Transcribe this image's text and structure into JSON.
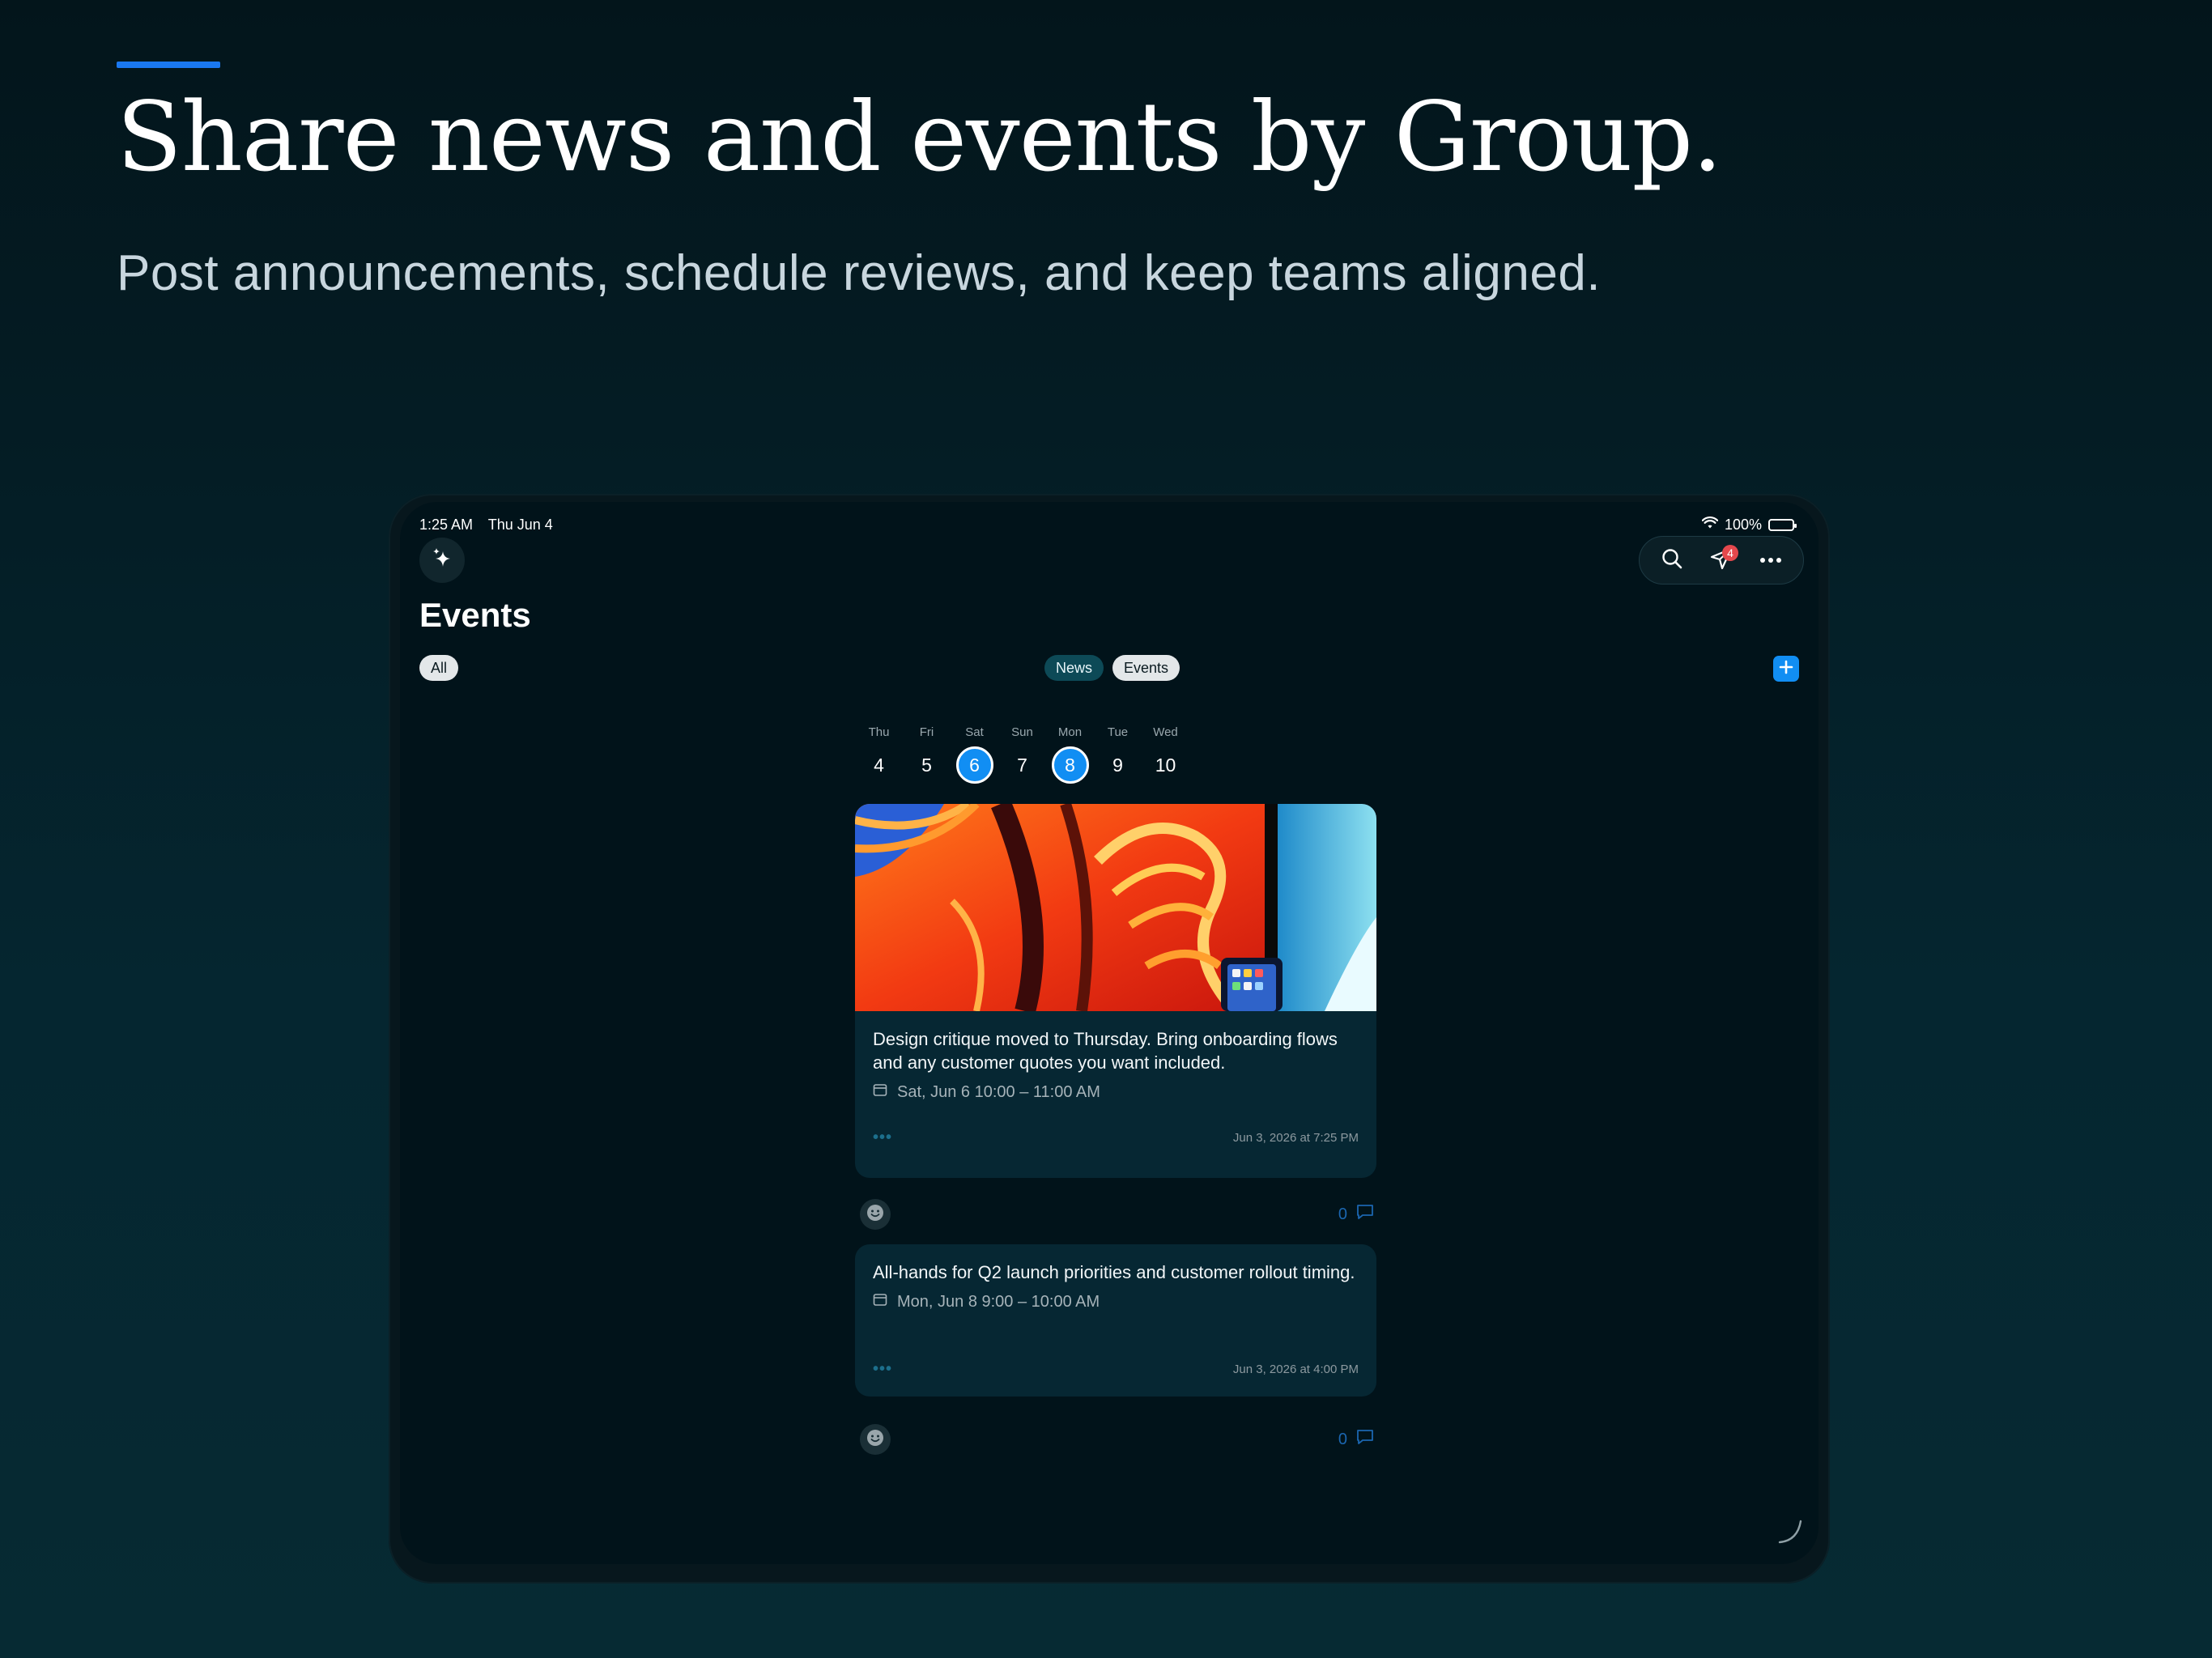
{
  "marketing": {
    "headline": "Share news and events by Group.",
    "subline": "Post announcements, schedule reviews, and keep teams aligned."
  },
  "status_bar": {
    "time": "1:25 AM",
    "date": "Thu Jun 4",
    "battery": "100%"
  },
  "toolbar": {
    "notification_count": "4"
  },
  "page": {
    "title": "Events"
  },
  "filters": {
    "all": "All",
    "news": "News",
    "events": "Events"
  },
  "week": [
    {
      "day": "Thu",
      "date": "4",
      "selected": false
    },
    {
      "day": "Fri",
      "date": "5",
      "selected": false
    },
    {
      "day": "Sat",
      "date": "6",
      "selected": true
    },
    {
      "day": "Sun",
      "date": "7",
      "selected": false
    },
    {
      "day": "Mon",
      "date": "8",
      "selected": true
    },
    {
      "day": "Tue",
      "date": "9",
      "selected": false
    },
    {
      "day": "Wed",
      "date": "10",
      "selected": false
    }
  ],
  "events": [
    {
      "text": "Design critique moved to Thursday. Bring onboarding flows and any customer quotes you want included.",
      "when": "Sat, Jun 6 10:00 – 11:00 AM",
      "timestamp": "Jun 3, 2026 at 7:25 PM",
      "comment_count": "0"
    },
    {
      "text": "All-hands for Q2 launch priorities and customer rollout timing.",
      "when": "Mon, Jun 8 9:00 – 10:00 AM",
      "timestamp": "Jun 3, 2026 at 4:00 PM",
      "comment_count": "0"
    }
  ],
  "colors": {
    "accent": "#118ef3",
    "badge": "#e5484d",
    "card": "#062733",
    "background": "#01131a"
  }
}
